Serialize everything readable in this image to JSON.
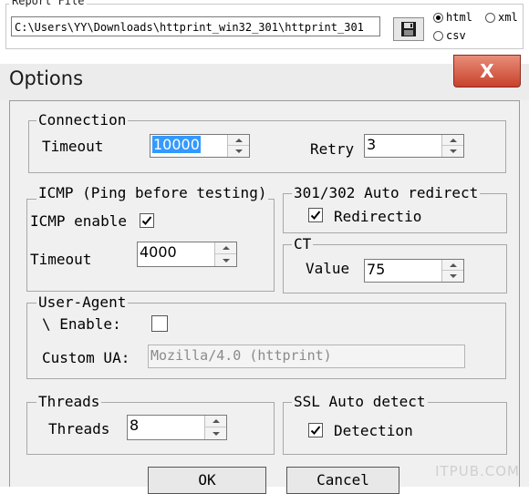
{
  "report": {
    "legend": "Report File",
    "path": "C:\\Users\\YY\\Downloads\\httprint_win32_301\\httprint_301",
    "format_html": "html",
    "format_xml": "xml",
    "format_csv": "csv"
  },
  "dialog": {
    "title": "Options",
    "close": "X"
  },
  "connection": {
    "legend": "Connection",
    "timeout_label": "Timeout",
    "timeout_value": "10000",
    "retry_label": "Retry",
    "retry_value": "3"
  },
  "icmp": {
    "legend": "ICMP (Ping before testing)",
    "enable_label": "ICMP enable",
    "timeout_label": "Timeout",
    "timeout_value": "4000"
  },
  "redirect": {
    "legend": "301/302 Auto redirect",
    "check_label": "Redirectio"
  },
  "ct": {
    "legend": "CT",
    "value_label": "Value",
    "value": "75"
  },
  "user_agent": {
    "legend": "User-Agent",
    "enable_label": "\\ Enable:",
    "custom_label": "Custom UA:",
    "custom_value": "Mozilla/4.0 (httprint)"
  },
  "threads": {
    "legend": "Threads",
    "label": "Threads",
    "value": "8"
  },
  "ssl": {
    "legend": "SSL Auto detect",
    "check_label": "Detection"
  },
  "buttons": {
    "ok": "OK",
    "cancel": "Cancel"
  },
  "watermark": "ITPUB.COM"
}
